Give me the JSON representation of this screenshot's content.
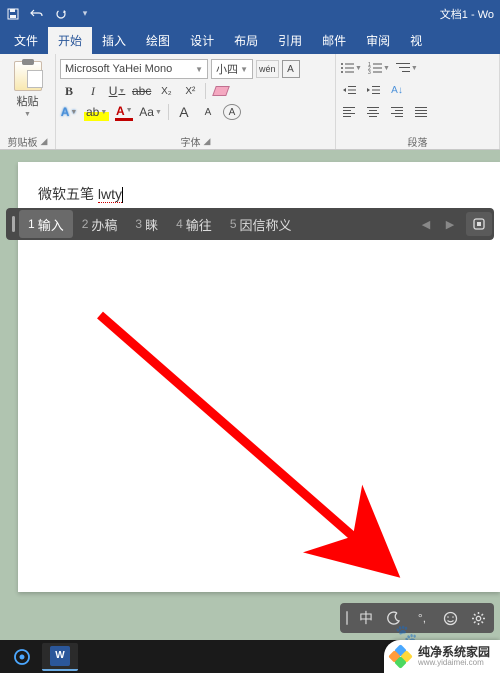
{
  "title": {
    "doc": "文档1 - Wo"
  },
  "tabs": {
    "file": "文件",
    "home": "开始",
    "insert": "插入",
    "draw": "绘图",
    "design": "设计",
    "layout": "布局",
    "references": "引用",
    "mailings": "邮件",
    "review": "审阅",
    "view": "视"
  },
  "ribbon_labels": {
    "clipboard": "剪贴板",
    "font": "字体",
    "paragraph": "段落",
    "paste": "粘贴"
  },
  "font": {
    "name": "Microsoft YaHei Mono",
    "size": "小四",
    "phonetic": "wén",
    "a_big": "A",
    "a_small": "A",
    "b": "B",
    "i": "I",
    "u": "U",
    "strike": "abc",
    "sub": "X₂",
    "sup": "X²",
    "aa": "Aa",
    "circled": "A",
    "highlight": "ab"
  },
  "doc": {
    "pre": "微软五笔 ",
    "composing": "lwty"
  },
  "ime": {
    "candidates": [
      {
        "n": "1",
        "t": "输入"
      },
      {
        "n": "2",
        "t": "办稿"
      },
      {
        "n": "3",
        "t": "睐"
      },
      {
        "n": "4",
        "t": "输往"
      },
      {
        "n": "5",
        "t": "因信称义"
      }
    ]
  },
  "ime_toolbar": {
    "mode": "中",
    "punct": "°,"
  },
  "watermark": {
    "title": "纯净系统家园",
    "url": "www.yidaimei.com"
  }
}
